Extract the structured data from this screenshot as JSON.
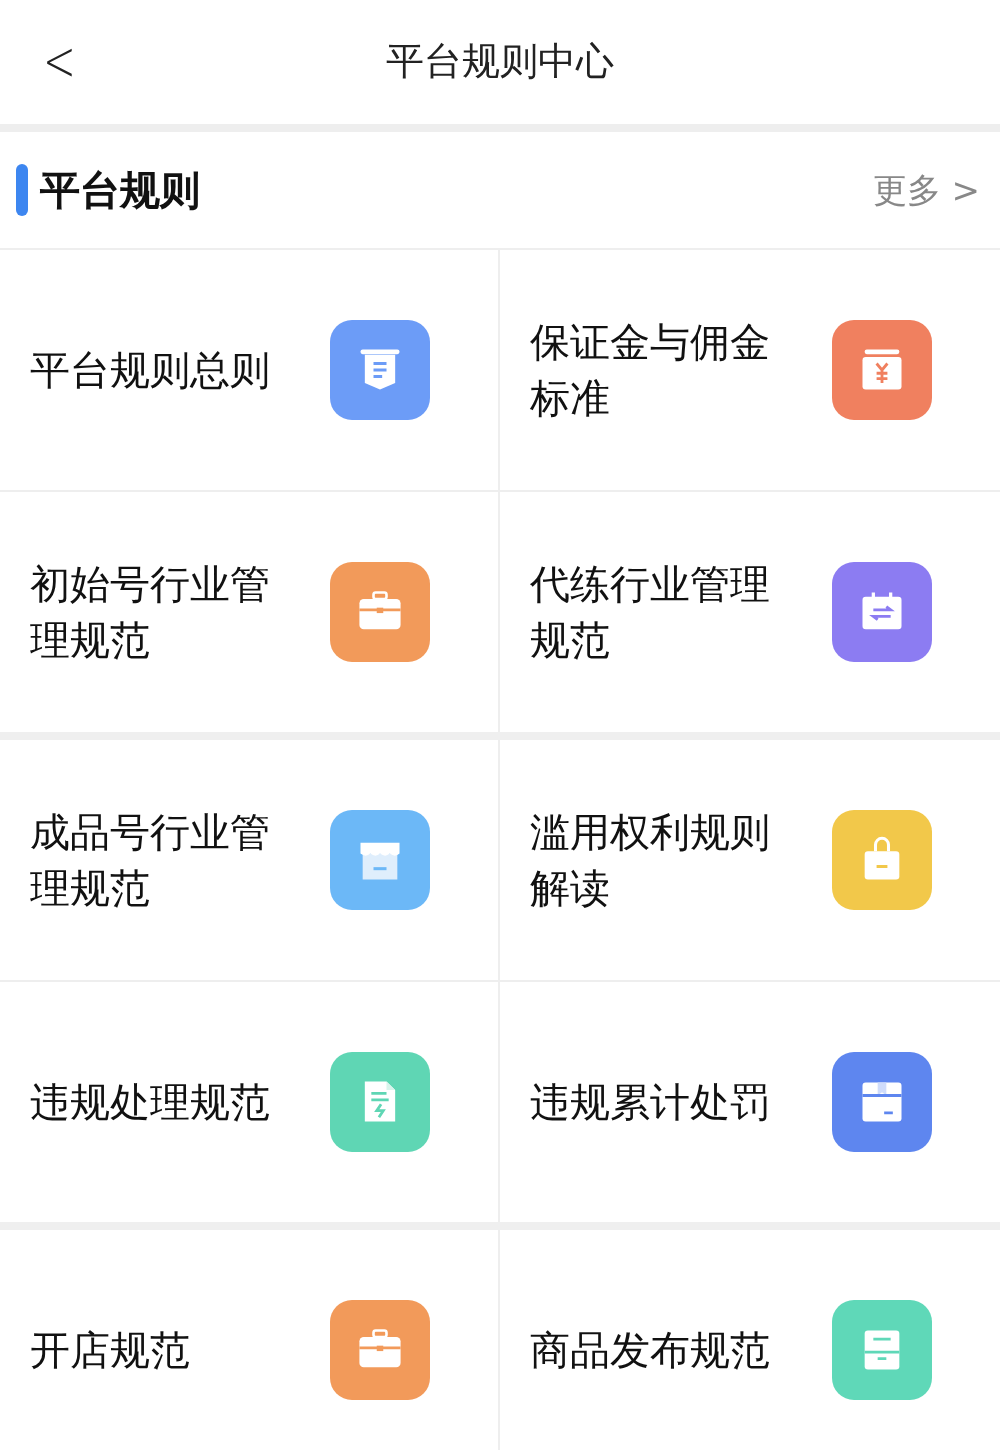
{
  "header": {
    "back": "<",
    "title": "平台规则中心"
  },
  "section": {
    "title": "平台规则",
    "more": "更多",
    "more_arrow": ">"
  },
  "groups": [
    [
      [
        {
          "label": "平台规则总则",
          "kind": "doc",
          "color": "#6c9cf7"
        },
        {
          "label": "保证金与佣金标准",
          "kind": "cash",
          "color": "#f0805f"
        }
      ],
      [
        {
          "label": "初始号行业管理规范",
          "kind": "case",
          "color": "#f29a5a"
        },
        {
          "label": "代练行业管理规范",
          "kind": "swap",
          "color": "#8c7cf2"
        }
      ]
    ],
    [
      [
        {
          "label": "成品号行业管理规范",
          "kind": "store",
          "color": "#6cb8f7"
        },
        {
          "label": "滥用权利规则解读",
          "kind": "bag",
          "color": "#f2c84a"
        }
      ],
      [
        {
          "label": "违规处理规范",
          "kind": "bolt",
          "color": "#5fd6b4"
        },
        {
          "label": "违规累计处罚",
          "kind": "box",
          "color": "#5e86ef"
        }
      ]
    ],
    [
      [
        {
          "label": "开店规范",
          "kind": "case",
          "color": "#f29a5a"
        },
        {
          "label": "商品发布规范",
          "kind": "note",
          "color": "#5fd8b8"
        }
      ]
    ]
  ]
}
